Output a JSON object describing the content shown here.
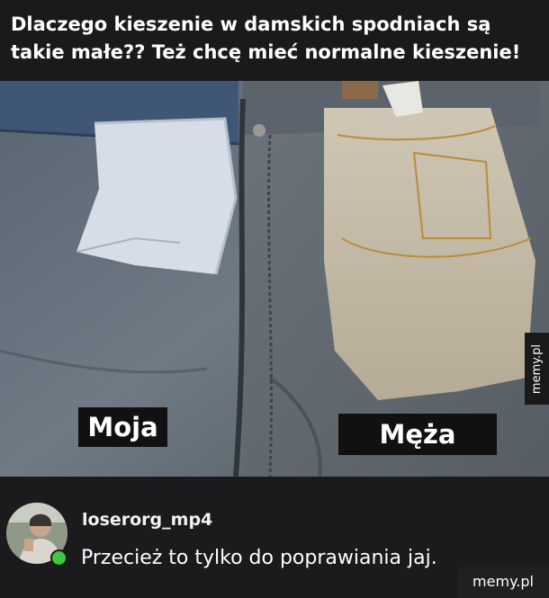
{
  "post": {
    "title": "Dlaczego kieszenie w damskich spodniach są takie małe?? Też chcę mieć normalne kieszenie!"
  },
  "image": {
    "label_left": "Moja",
    "label_right": "Męża",
    "side_watermark": "memy.pl"
  },
  "comment": {
    "username": "loserorg_mp4",
    "text": "Przecież to tylko do poprawiania jaj.",
    "status": "online"
  },
  "footer": {
    "watermark": "memy.pl"
  },
  "colors": {
    "header_bg": "#1a1a1a",
    "comment_bg": "#1b1b1d",
    "online_dot": "#3ec840"
  }
}
